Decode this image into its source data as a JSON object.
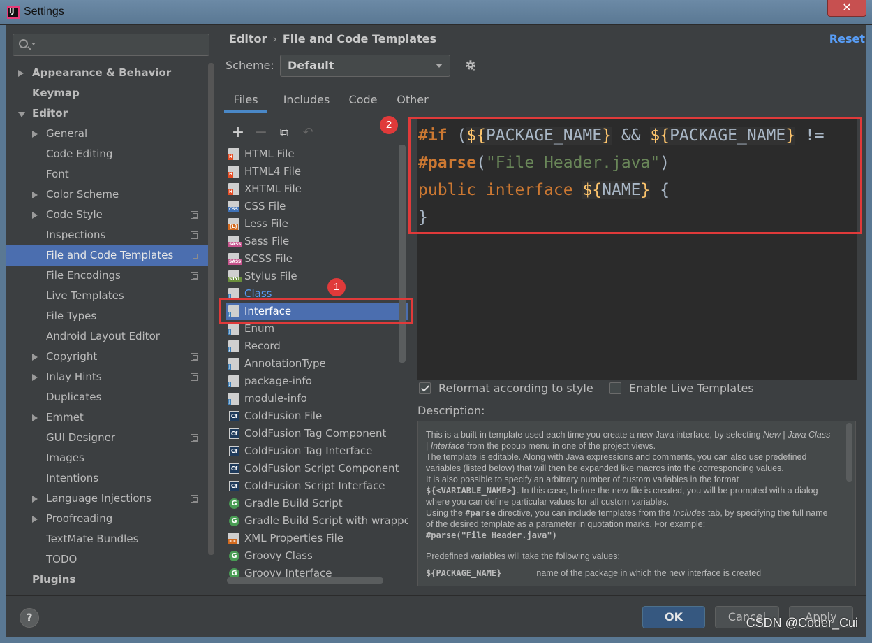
{
  "window": {
    "title": "Settings",
    "close_glyph": "✕"
  },
  "sidebar": {
    "search_placeholder": "",
    "items": [
      {
        "label": "Appearance & Behavior",
        "level": 0,
        "bold": true,
        "arrow": "closed"
      },
      {
        "label": "Keymap",
        "level": 0,
        "bold": true,
        "arrow": "none"
      },
      {
        "label": "Editor",
        "level": 0,
        "bold": true,
        "arrow": "open"
      },
      {
        "label": "General",
        "level": 1,
        "arrow": "closed"
      },
      {
        "label": "Code Editing",
        "level": 1,
        "arrow": "none"
      },
      {
        "label": "Font",
        "level": 1,
        "arrow": "none"
      },
      {
        "label": "Color Scheme",
        "level": 1,
        "arrow": "closed"
      },
      {
        "label": "Code Style",
        "level": 1,
        "arrow": "closed",
        "proj": true
      },
      {
        "label": "Inspections",
        "level": 1,
        "arrow": "none",
        "proj": true
      },
      {
        "label": "File and Code Templates",
        "level": 1,
        "arrow": "none",
        "proj": true,
        "selected": true
      },
      {
        "label": "File Encodings",
        "level": 1,
        "arrow": "none",
        "proj": true
      },
      {
        "label": "Live Templates",
        "level": 1,
        "arrow": "none"
      },
      {
        "label": "File Types",
        "level": 1,
        "arrow": "none"
      },
      {
        "label": "Android Layout Editor",
        "level": 1,
        "arrow": "none"
      },
      {
        "label": "Copyright",
        "level": 1,
        "arrow": "closed",
        "proj": true
      },
      {
        "label": "Inlay Hints",
        "level": 1,
        "arrow": "closed",
        "proj": true
      },
      {
        "label": "Duplicates",
        "level": 1,
        "arrow": "none"
      },
      {
        "label": "Emmet",
        "level": 1,
        "arrow": "closed"
      },
      {
        "label": "GUI Designer",
        "level": 1,
        "arrow": "none",
        "proj": true
      },
      {
        "label": "Images",
        "level": 1,
        "arrow": "none"
      },
      {
        "label": "Intentions",
        "level": 1,
        "arrow": "none"
      },
      {
        "label": "Language Injections",
        "level": 1,
        "arrow": "closed",
        "proj": true
      },
      {
        "label": "Proofreading",
        "level": 1,
        "arrow": "closed"
      },
      {
        "label": "TextMate Bundles",
        "level": 1,
        "arrow": "none"
      },
      {
        "label": "TODO",
        "level": 1,
        "arrow": "none"
      },
      {
        "label": "Plugins",
        "level": 0,
        "bold": true,
        "arrow": "none"
      }
    ]
  },
  "header": {
    "breadcrumb_1": "Editor",
    "breadcrumb_sep": "›",
    "breadcrumb_2": "File and Code Templates",
    "reset_label": "Reset"
  },
  "scheme": {
    "label": "Scheme:",
    "value": "Default"
  },
  "tabs": [
    {
      "label": "Files",
      "active": true
    },
    {
      "label": "Includes"
    },
    {
      "label": "Code"
    },
    {
      "label": "Other"
    }
  ],
  "toolbar": {
    "add": "+",
    "remove": "−",
    "copy": "⧉",
    "reset": "↶"
  },
  "templates": [
    {
      "label": "HTML File",
      "icon": "html-file-icon",
      "tag": "H",
      "color": "#e44d26"
    },
    {
      "label": "HTML4 File",
      "icon": "html-file-icon",
      "tag": "H",
      "color": "#e44d26"
    },
    {
      "label": "XHTML File",
      "icon": "html-file-icon",
      "tag": "H",
      "color": "#e44d26"
    },
    {
      "label": "CSS File",
      "icon": "css-file-icon",
      "tag": "CSS",
      "color": "#3f72b8"
    },
    {
      "label": "Less File",
      "icon": "less-file-icon",
      "tag": "{L}",
      "color": "#d2691e"
    },
    {
      "label": "Sass File",
      "icon": "sass-file-icon",
      "tag": "SASS",
      "color": "#c6538c"
    },
    {
      "label": "SCSS File",
      "icon": "sass-file-icon",
      "tag": "SASS",
      "color": "#c6538c"
    },
    {
      "label": "Stylus File",
      "icon": "stylus-file-icon",
      "tag": "STYL",
      "color": "#6a8f3c"
    },
    {
      "label": "Class",
      "icon": "java-file-icon",
      "tag": "J",
      "color": "#3d7fb8",
      "link": true
    },
    {
      "label": "Interface",
      "icon": "java-file-icon",
      "tag": "J",
      "color": "#3d7fb8",
      "selected": true
    },
    {
      "label": "Enum",
      "icon": "java-file-icon",
      "tag": "J",
      "color": "#3d7fb8"
    },
    {
      "label": "Record",
      "icon": "java-file-icon",
      "tag": "J",
      "color": "#3d7fb8"
    },
    {
      "label": "AnnotationType",
      "icon": "java-file-icon",
      "tag": "J",
      "color": "#3d7fb8"
    },
    {
      "label": "package-info",
      "icon": "java-file-icon",
      "tag": "J",
      "color": "#3d7fb8"
    },
    {
      "label": "module-info",
      "icon": "java-file-icon",
      "tag": "J",
      "color": "#3d7fb8"
    },
    {
      "label": "ColdFusion File",
      "icon": "coldfusion-icon",
      "tag": "Cf"
    },
    {
      "label": "ColdFusion Tag Component",
      "icon": "coldfusion-icon",
      "tag": "Cf"
    },
    {
      "label": "ColdFusion Tag Interface",
      "icon": "coldfusion-icon",
      "tag": "Cf"
    },
    {
      "label": "ColdFusion Script Component",
      "icon": "coldfusion-icon",
      "tag": "Cf"
    },
    {
      "label": "ColdFusion Script Interface",
      "icon": "coldfusion-icon",
      "tag": "Cf"
    },
    {
      "label": "Gradle Build Script",
      "icon": "gradle-icon",
      "tag": "G"
    },
    {
      "label": "Gradle Build Script with wrapper",
      "icon": "gradle-icon",
      "tag": "G"
    },
    {
      "label": "XML Properties File",
      "icon": "xml-file-icon",
      "tag": "<>",
      "color": "#d2691e"
    },
    {
      "label": "Groovy Class",
      "icon": "groovy-icon",
      "tag": "G"
    },
    {
      "label": "Groovy Interface",
      "icon": "groovy-icon",
      "tag": "G"
    }
  ],
  "editor": {
    "line1_a": "#if",
    "line1_b": " (",
    "line1_c": "${",
    "line1_d": "PACKAGE_NAME",
    "line1_e": "}",
    "line1_f": " && ",
    "line1_g": "${",
    "line1_h": "PACKAGE_NAME",
    "line1_i": "}",
    "line1_j": " !=",
    "line2_a": "#parse",
    "line2_b": "(",
    "line2_c": "\"File Header.java\"",
    "line2_d": ")",
    "line3_a": "public",
    "line3_b": " ",
    "line3_c": "interface",
    "line3_d": " ",
    "line3_e": "${",
    "line3_f": "NAME",
    "line3_g": "}",
    "line3_h": " {",
    "line4_a": "}"
  },
  "options": {
    "reformat_label": "Reformat according to style",
    "reformat_checked": true,
    "live_templates_label": "Enable Live Templates",
    "live_templates_checked": false
  },
  "description": {
    "label": "Description:",
    "p1_a": "This is a built-in template used each time you create a new Java interface, by selecting ",
    "p1_new": "New",
    "p1_b": " | ",
    "p1_java_class": "Java Class",
    "p1_c": " | ",
    "p1_interface": "Interface",
    "p1_d": " from the popup menu in one of the project views.",
    "p2": "The template is editable. Along with Java expressions and comments, you can also use predefined variables (listed below) that will then be expanded like macros into the corresponding values.",
    "p3_a": "It is also possible to specify an arbitrary number of custom variables in the format ",
    "p3_code": "${<VARIABLE_NAME>}",
    "p3_b": ". In this case, before the new file is created, you will be prompted with a dialog where you can define particular values for all custom variables.",
    "p4_a": "Using the ",
    "p4_parse": "#parse",
    "p4_b": " directive, you can include templates from the ",
    "p4_includes": "Includes",
    "p4_c": " tab, by specifying the full name of the desired template as a parameter in quotation marks. For example:",
    "p4_example": "#parse(\"File Header.java\")",
    "p5": "Predefined variables will take the following values:",
    "p6_var": "${PACKAGE_NAME}",
    "p6_desc": "name of the package in which the new interface is created"
  },
  "annotations": {
    "badge1": "1",
    "badge2": "2"
  },
  "footer": {
    "help": "?",
    "ok": "OK",
    "cancel": "Cancel",
    "apply": "Apply",
    "watermark": "CSDN @Coder_Cui"
  },
  "colors": {
    "accent": "#4b6eaf",
    "link": "#589df6",
    "annotation": "#e03a3a"
  }
}
